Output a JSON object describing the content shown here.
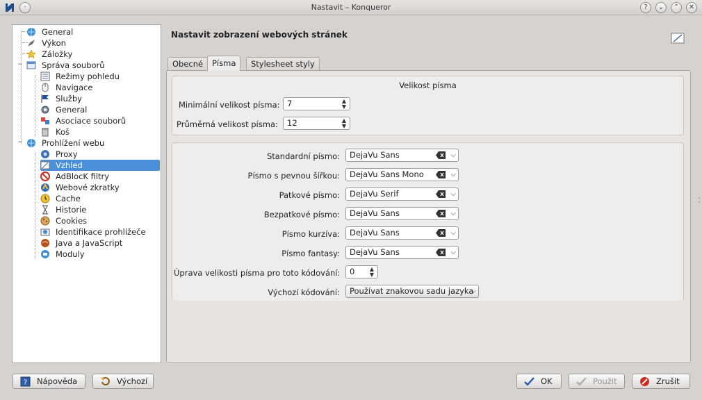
{
  "window": {
    "title": "Nastavit – Konqueror",
    "buttons": {
      "help": "?",
      "minimize": "⌄",
      "maximize": "⌃",
      "close": "✕"
    }
  },
  "sidebar": {
    "items": [
      {
        "label": "General",
        "icon": "globe-icon"
      },
      {
        "label": "Výkon",
        "icon": "rocket-icon"
      },
      {
        "label": "Záložky",
        "icon": "star-icon"
      },
      {
        "label": "Správa souborů",
        "icon": "file-manager-icon"
      },
      {
        "label": "Režimy pohledu",
        "icon": "view-modes-icon"
      },
      {
        "label": "Navigace",
        "icon": "mouse-icon"
      },
      {
        "label": "Služby",
        "icon": "flag-icon"
      },
      {
        "label": "General",
        "icon": "gear-icon"
      },
      {
        "label": "Asociace souborů",
        "icon": "file-association-icon"
      },
      {
        "label": "Koš",
        "icon": "trash-icon"
      },
      {
        "label": "Prohlížení webu",
        "icon": "globe-icon"
      },
      {
        "label": "Proxy",
        "icon": "proxy-icon"
      },
      {
        "label": "Vzhled",
        "icon": "appearance-icon"
      },
      {
        "label": "AdBlocK filtry",
        "icon": "adblock-icon"
      },
      {
        "label": "Webové zkratky",
        "icon": "web-shortcuts-icon"
      },
      {
        "label": "Cache",
        "icon": "cache-icon"
      },
      {
        "label": "Historie",
        "icon": "history-icon"
      },
      {
        "label": "Cookies",
        "icon": "cookie-icon"
      },
      {
        "label": "Identifikace prohlížeče",
        "icon": "browser-id-icon"
      },
      {
        "label": "Java a JavaScript",
        "icon": "java-icon"
      },
      {
        "label": "Moduly",
        "icon": "plugins-icon"
      }
    ],
    "selected": "Vzhled"
  },
  "header": {
    "title": "Nastavit zobrazení webových stránek"
  },
  "tabs": [
    {
      "label": "Obecné"
    },
    {
      "label": "Písma"
    },
    {
      "label": "Stylesheet styly"
    }
  ],
  "active_tab": "Písma",
  "font_size_group": {
    "title": "Velikost písma",
    "min_label": "Minimální velikost písma:",
    "min_value": "7",
    "avg_label": "Průměrná velikost písma:",
    "avg_value": "12"
  },
  "fonts": [
    {
      "label": "Standardní písmo:",
      "value": "DejaVu Sans"
    },
    {
      "label": "Písmo s pevnou šířkou:",
      "value": "DejaVu Sans Mono"
    },
    {
      "label": "Patkové písmo:",
      "value": "DejaVu Serif"
    },
    {
      "label": "Bezpatkové písmo:",
      "value": "DejaVu Sans"
    },
    {
      "label": "Písmo kurzíva:",
      "value": "DejaVu Sans"
    },
    {
      "label": "Písmo fantasy:",
      "value": "DejaVu Sans"
    }
  ],
  "adjust": {
    "label": "Úprava velikosti písma pro toto kódování:",
    "value": "0"
  },
  "encoding": {
    "label": "Výchozí kódování:",
    "value": "Používat znakovou sadu jazyka"
  },
  "footer": {
    "help": "Nápověda",
    "defaults": "Výchozí",
    "ok": "OK",
    "apply": "Použít",
    "cancel": "Zrušit"
  },
  "colors": {
    "selection": "#4a8fd8",
    "window_bg": "#d6d2d0"
  }
}
